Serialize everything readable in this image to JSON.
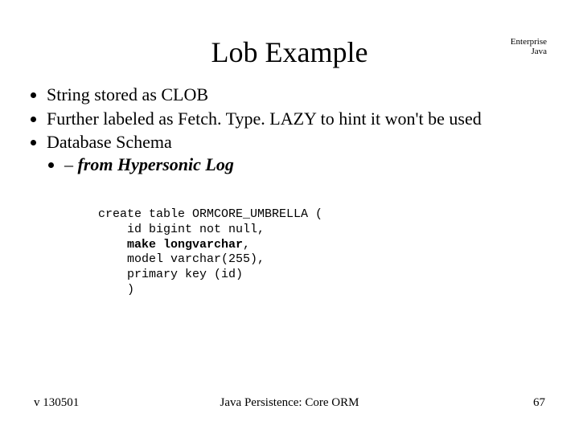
{
  "header": {
    "title": "Lob Example",
    "tag_line1": "Enterprise",
    "tag_line2": "Java"
  },
  "bullets": {
    "b1": "String stored as CLOB",
    "b2": "Further labeled as Fetch. Type. LAZY to hint it won't be used",
    "b3": "Database Schema",
    "sub1": "from Hypersonic Log"
  },
  "code": {
    "l1": "create table ORMCORE_UMBRELLA (",
    "l2": "    id bigint not null,",
    "l3a": "    ",
    "l3b": "make longvarchar",
    "l3c": ",",
    "l4": "    model varchar(255),",
    "l5": "    primary key (id)",
    "l6": "    )"
  },
  "footer": {
    "left": "v 130501",
    "center": "Java Persistence: Core ORM",
    "right": "67"
  }
}
